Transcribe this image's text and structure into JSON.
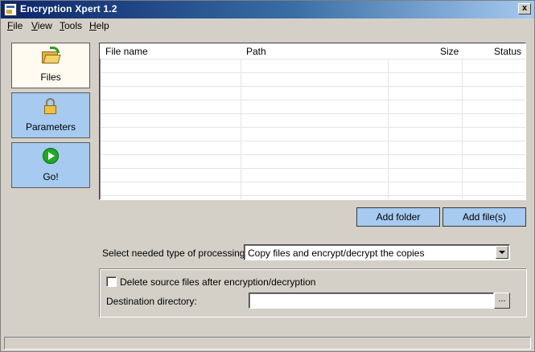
{
  "window": {
    "title": "Encryption Xpert 1.2",
    "close_label": "x"
  },
  "menu": [
    {
      "label": "File",
      "accel": "F",
      "rest": "ile"
    },
    {
      "label": "View",
      "accel": "V",
      "rest": "iew"
    },
    {
      "label": "Tools",
      "accel": "T",
      "rest": "ools"
    },
    {
      "label": "Help",
      "accel": "H",
      "rest": "elp"
    }
  ],
  "nav": {
    "files": {
      "label": "Files",
      "icon": "folder-refresh-icon"
    },
    "parameters": {
      "label": "Parameters",
      "icon": "lock-icon"
    },
    "go": {
      "label": "Go!",
      "icon": "play-icon"
    }
  },
  "filelist": {
    "columns": [
      "File name",
      "Path",
      "Size",
      "Status"
    ],
    "rows": []
  },
  "buttons": {
    "add_folder": "Add folder",
    "add_files": "Add file(s)"
  },
  "processing": {
    "label": "Select needed type of processing :",
    "selected": "Copy files and encrypt/decrypt the copies"
  },
  "options": {
    "delete_source_label": "Delete source files after encryption/decryption",
    "delete_source_checked": false,
    "destination_label": "Destination directory:",
    "destination_value": "",
    "browse_label": "..."
  },
  "colors": {
    "accent_button": "#a6caf0",
    "window_bg": "#d4d0c8",
    "active_nav": "#fffbf0"
  }
}
